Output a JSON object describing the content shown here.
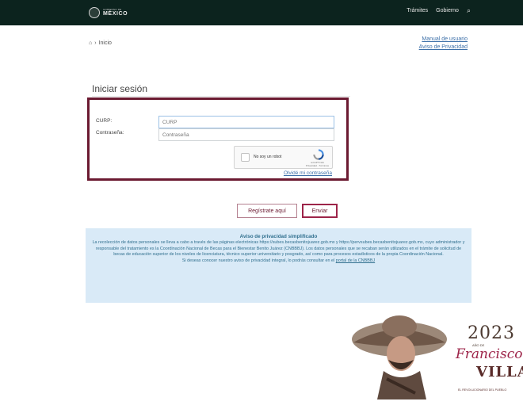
{
  "header": {
    "logo_small": "GOBIERNO DE",
    "logo_main": "MÉXICO",
    "nav": [
      "Trámites",
      "Gobierno"
    ],
    "search_icon": "search-icon"
  },
  "breadcrumb": {
    "home_icon": "home-icon",
    "separator": "›",
    "current": "Inicio"
  },
  "top_links": [
    "Manual de usuario",
    "Aviso de Privacidad"
  ],
  "login": {
    "title": "Iniciar sesión",
    "curp_label": "CURP:",
    "curp_placeholder": "CURP",
    "password_label": "Contraseña:",
    "password_placeholder": "Contraseña",
    "captcha_label": "No soy un robot",
    "captcha_brand": "reCAPTCHA",
    "captcha_terms": "Privacidad - Términos",
    "forgot": "Olvidé mi contraseña"
  },
  "buttons": {
    "register": "Regístrate aquí",
    "submit": "Enviar"
  },
  "privacy": {
    "title": "Aviso de privacidad simplificado",
    "body": "La recolección de datos personales se lleva a cabo a través de las páginas electrónicas https://subes.becasbenitojuarez.gob.mx y https://pervsubes.becasbenitojuarez.gob.mx, cuyo administrador y responsable del tratamiento es la Coordinación Nacional de Becas para el Bienestar Benito Juárez (CNBBBJ). Los datos personales que se recaban serán utilizados en el trámite de solicitud de becas de educación superior de los niveles de licenciatura, técnico superior universitario y posgrado, así como para procesos estadísticos de la propia Coordinación Nacional.",
    "footer_prefix": "Si deseas conocer nuestro aviso de privacidad integral, lo podrás consultar en el",
    "footer_link": "portal de la CNBBBJ"
  },
  "banner": {
    "year": "2023",
    "ano_de": "AÑO DE",
    "name_first": "Francisco",
    "name_last": "VILLA",
    "tagline": "EL REVOLUCIONARIO DEL PUEBLO"
  },
  "colors": {
    "header_bg": "#0c231e",
    "accent": "#6b1a31",
    "link": "#3c6fa8",
    "notice_bg": "#d9eaf7"
  }
}
